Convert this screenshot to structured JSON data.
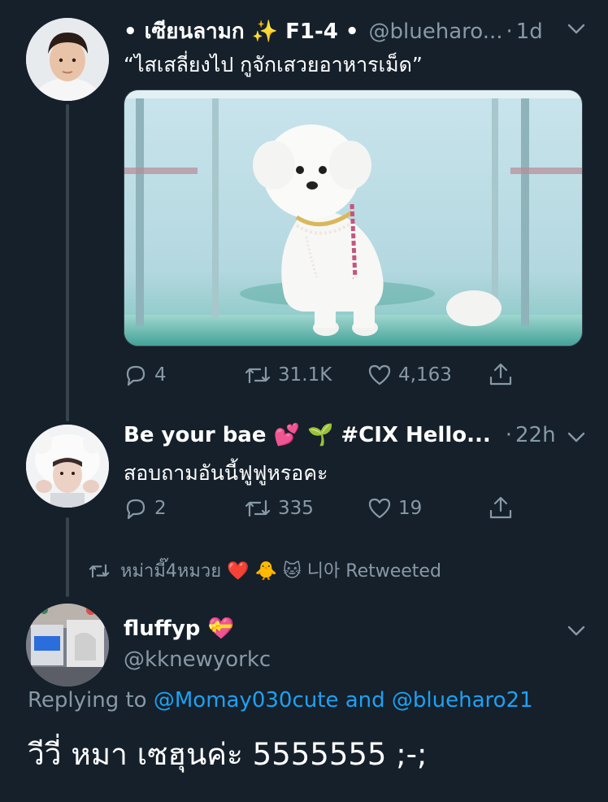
{
  "tweet1": {
    "display_name": "• เซียนลามก ✨ F1-4 •",
    "handle": "@blueharo...",
    "separator": "·",
    "time": "1d",
    "text": "“ไสเสลี่ยงไป กูจักเสวยอาหารเม็ด”",
    "reply_count": "4",
    "retweet_count": "31.1K",
    "like_count": "4,163"
  },
  "tweet2": {
    "display_name": "Be your bae 💕 🌱 #CIX Hello...",
    "separator": "·",
    "time": "22h",
    "text": "สอบถามอันนี้ฟูฟูหรอคะ",
    "reply_count": "2",
    "retweet_count": "335",
    "like_count": "19"
  },
  "retweet_banner": {
    "text": "หม่ามี๊4หมวย ❤️ 🐥 🐱 니아 Retweeted"
  },
  "tweet3": {
    "display_name": "fluffyp 💝",
    "handle": "@kknewyorkc",
    "replying_prefix": "Replying to",
    "mention1": "@Momay030cute",
    "and": "and",
    "mention2": "@blueharo21",
    "text": "วีวี่ หมา เซฮุนค่ะ 5555555 ;-;"
  },
  "colors": {
    "background": "#15202b",
    "text": "#ffffff",
    "secondary": "#8899a6",
    "accent": "#1da1f2",
    "divider": "#38444d"
  }
}
